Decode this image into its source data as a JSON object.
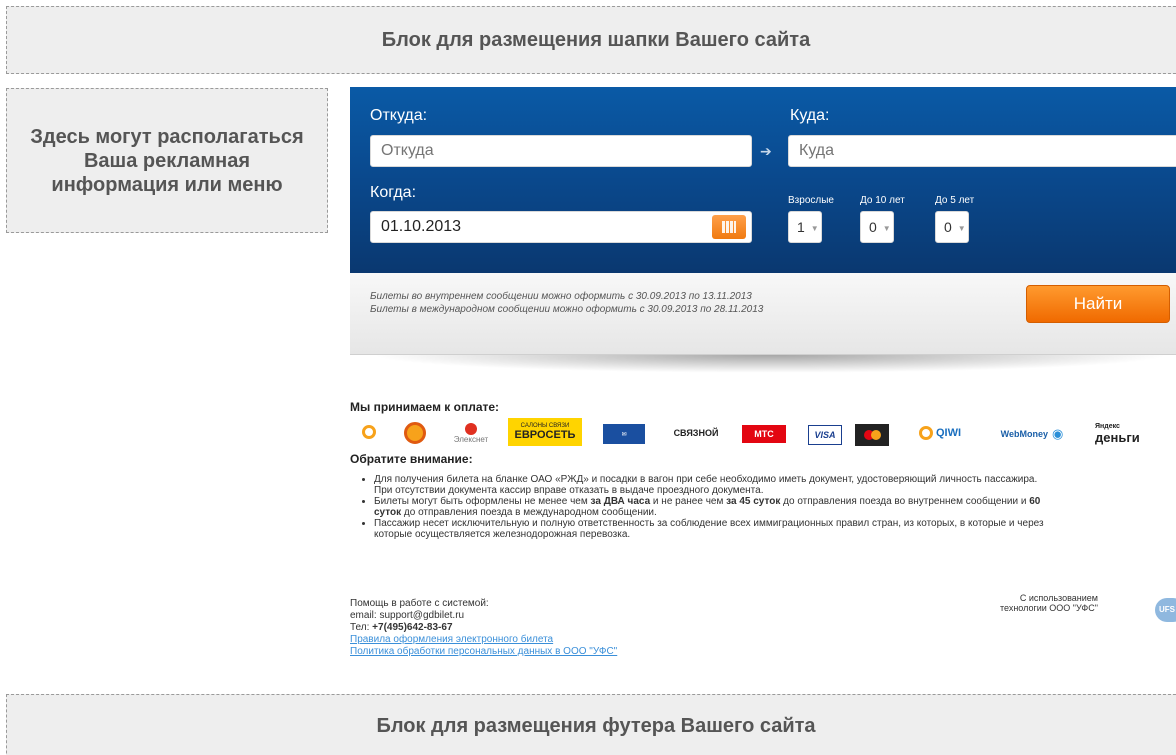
{
  "header_block": "Блок для размещения шапки Вашего сайта",
  "side_block": "Здесь могут располагаться Ваша рекламная информация или меню",
  "footer_block": "Блок для размещения футера Вашего сайта",
  "search": {
    "from_label": "Откуда:",
    "from_placeholder": "Откуда",
    "to_label": "Куда:",
    "to_placeholder": "Куда",
    "when_label": "Когда:",
    "date_value": "01.10.2013",
    "adults_label": "Взрослые",
    "adults_value": "1",
    "under10_label": "До 10 лет",
    "under10_value": "0",
    "under5_label": "До 5 лет",
    "under5_value": "0",
    "note_domestic": "Билеты во внутреннем сообщении можно оформить с 30.09.2013 по 13.11.2013",
    "note_international": "Билеты в международном сообщении можно оформить с 30.09.2013 по 28.11.2013",
    "find_button": "Найти"
  },
  "payment": {
    "title": "Мы принимаем к оплате:",
    "logos": [
      "QIWI",
      "Свободная касса",
      "Элекснет",
      "Евросеть",
      "Почта России",
      "Связной",
      "МТС",
      "VISA",
      "MasterCard",
      "QIWI",
      "WebMoney",
      "Яндекс деньги"
    ],
    "euroset_top": "САЛОНЫ СВЯЗИ",
    "euroset_main": "ЕВРОСЕТЬ",
    "svyaznoy": "СВЯЗНОЙ",
    "mts": "МТС",
    "visa": "VISA",
    "qiwi": "QIWI",
    "webmoney": "WebMoney",
    "yandex_top": "Яндекс",
    "yandex_main": "деньги",
    "eleksnet": "Элекснет"
  },
  "attention": {
    "title": "Обратите внимание:",
    "items": [
      "Для получения билета на бланке ОАО «РЖД» и посадки в вагон при себе необходимо иметь документ, удостоверяющий личность пассажира. При отсутствии документа кассир вправе отказать в выдаче проездного документа.",
      "Билеты могут быть оформлены не менее чем за ДВА часа и не ранее чем за 45 суток до отправления поезда во внутреннем сообщении и 60 суток до отправления поезда в международном сообщении.",
      "Пассажир несет исключительную и полную ответственность за соблюдение всех иммиграционных правил стран, из которых, в которые и через которые осуществляется железнодорожная перевозка."
    ]
  },
  "help": {
    "line1": "Помощь в работе с системой:",
    "email": "email: support@gdbilet.ru",
    "phone_prefix": "Тел: ",
    "phone": "+7(495)642-83-67",
    "link1": "Правила оформления электронного билета",
    "link2": "Политика обработки персональных данных в ООО \"УФС\""
  },
  "ufs": {
    "line1": "С использованием",
    "line2": "технологии ООО \"УФС\"",
    "logo": "UFS"
  }
}
